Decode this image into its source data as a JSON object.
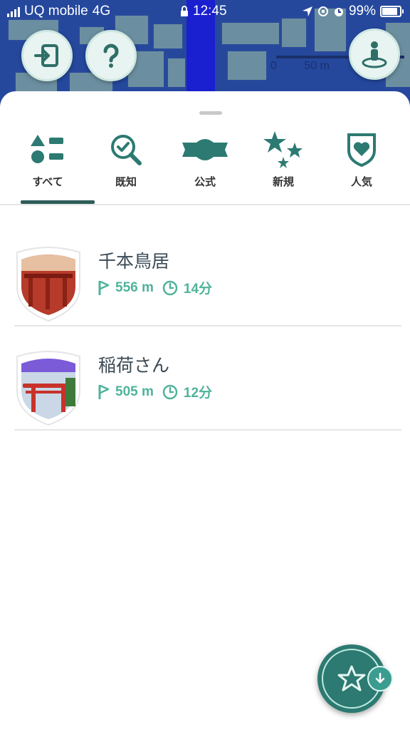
{
  "status_bar": {
    "carrier": "UQ mobile",
    "network": "4G",
    "time": "12:45",
    "battery": "99%"
  },
  "map": {
    "scale_label_0": "0",
    "scale_label_1": "50 m"
  },
  "tabs": [
    {
      "label": "すべて",
      "icon": "all-categories-icon",
      "active": true
    },
    {
      "label": "既知",
      "icon": "search-check-icon"
    },
    {
      "label": "公式",
      "icon": "official-banner-icon"
    },
    {
      "label": "新規",
      "icon": "stars-icon"
    },
    {
      "label": "人気",
      "icon": "heart-shield-icon"
    }
  ],
  "routes": [
    {
      "title": "千本鳥居",
      "distance": "556 m",
      "duration": "14分",
      "badge_color": "#c9503a"
    },
    {
      "title": "稲荷さん",
      "distance": "505 m",
      "duration": "12分",
      "badge_color": "#7b5bd8"
    }
  ],
  "colors": {
    "accent": "#2c7a72",
    "meta_text": "#4fb39a",
    "map_bg": "#1e3c8f"
  }
}
